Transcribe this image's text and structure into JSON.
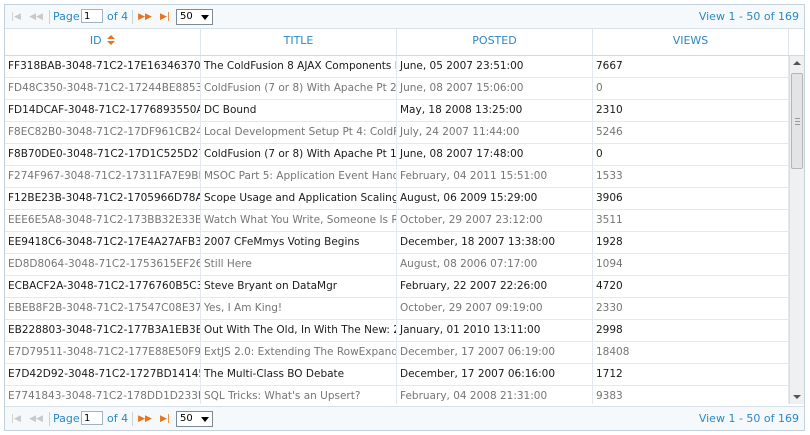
{
  "pager": {
    "page_label": "Page",
    "current_page": "1",
    "of_label": "of 4",
    "page_size": "50",
    "info": "View 1 - 50 of 169"
  },
  "columns": [
    {
      "label": "ID",
      "sorted": "asc"
    },
    {
      "label": "TITLE"
    },
    {
      "label": "POSTED"
    },
    {
      "label": "VIEWS"
    }
  ],
  "rows": [
    {
      "id": "FF318BAB-3048-71C2-17E1634637074E",
      "title": "The ColdFusion 8 AJAX Components Det",
      "posted": "June, 05 2007 23:51:00",
      "views": "7667"
    },
    {
      "id": "FD48C350-3048-71C2-17244BE88532D8",
      "title": "ColdFusion (7 or 8) With Apache Pt 2: N",
      "posted": "June, 08 2007 15:06:00",
      "views": "0"
    },
    {
      "id": "FD14DCAF-3048-71C2-1776893550A7CD",
      "title": "DC Bound",
      "posted": "May, 18 2008 13:25:00",
      "views": "2310"
    },
    {
      "id": "F8EC82B0-3048-71C2-17DF961CB24198",
      "title": "Local Development Setup Pt 4: ColdFus",
      "posted": "July, 24 2007 11:44:00",
      "views": "5246"
    },
    {
      "id": "F8B70DE0-3048-71C2-17D1C525D27F1C",
      "title": "ColdFusion (7 or 8) With Apache Pt 1: U",
      "posted": "June, 08 2007 17:48:00",
      "views": "0"
    },
    {
      "id": "F274F967-3048-71C2-17311FA7E9BD23",
      "title": "MSOC Part 5: Application Event Handle",
      "posted": "February, 04 2011 15:51:00",
      "views": "1533"
    },
    {
      "id": "F12BE23B-3048-71C2-1705966D78A678",
      "title": "Scope Usage and Application Scaling",
      "posted": "August, 06 2009 15:29:00",
      "views": "3906"
    },
    {
      "id": "EEE6E5A8-3048-71C2-173BB32E33BC86",
      "title": "Watch What You Write, Someone Is Re",
      "posted": "October, 29 2007 23:12:00",
      "views": "3511"
    },
    {
      "id": "EE9418C6-3048-71C2-17E4A27AFB3E75",
      "title": "2007 CFeMmys Voting Begins",
      "posted": "December, 18 2007 13:38:00",
      "views": "1928"
    },
    {
      "id": "ED8D8064-3048-71C2-1753615EF26A66",
      "title": "Still Here",
      "posted": "August, 08 2006 07:17:00",
      "views": "1094"
    },
    {
      "id": "ECBACF2A-3048-71C2-1776760B5C3C7F",
      "title": "Steve Bryant on DataMgr",
      "posted": "February, 22 2007 22:26:00",
      "views": "4720"
    },
    {
      "id": "EBEB8F2B-3048-71C2-17547C08E3776E",
      "title": "Yes, I Am King!",
      "posted": "October, 29 2007 09:19:00",
      "views": "2330"
    },
    {
      "id": "EB228803-3048-71C2-177B3A1EB3BB6B",
      "title": "Out With The Old, In With The New: 20",
      "posted": "January, 01 2010 13:11:00",
      "views": "2998"
    },
    {
      "id": "E7D79511-3048-71C2-177E88E50F9A69",
      "title": "ExtJS 2.0: Extending The RowExpander",
      "posted": "December, 17 2007 06:19:00",
      "views": "18408"
    },
    {
      "id": "E7D42D92-3048-71C2-1727BD14145512",
      "title": "The Multi-Class BO Debate",
      "posted": "December, 17 2007 06:16:00",
      "views": "1712"
    },
    {
      "id": "E7741843-3048-71C2-178DD1D233B51F",
      "title": "SQL Tricks: What's an Upsert?",
      "posted": "February, 04 2008 21:31:00",
      "views": "9383"
    }
  ],
  "icons": {
    "first": "first-page-icon",
    "prev": "prev-page-icon",
    "next": "next-page-icon",
    "last": "last-page-icon"
  },
  "colors": {
    "accent": "#2a88c4",
    "nav_active": "#e8731c"
  }
}
